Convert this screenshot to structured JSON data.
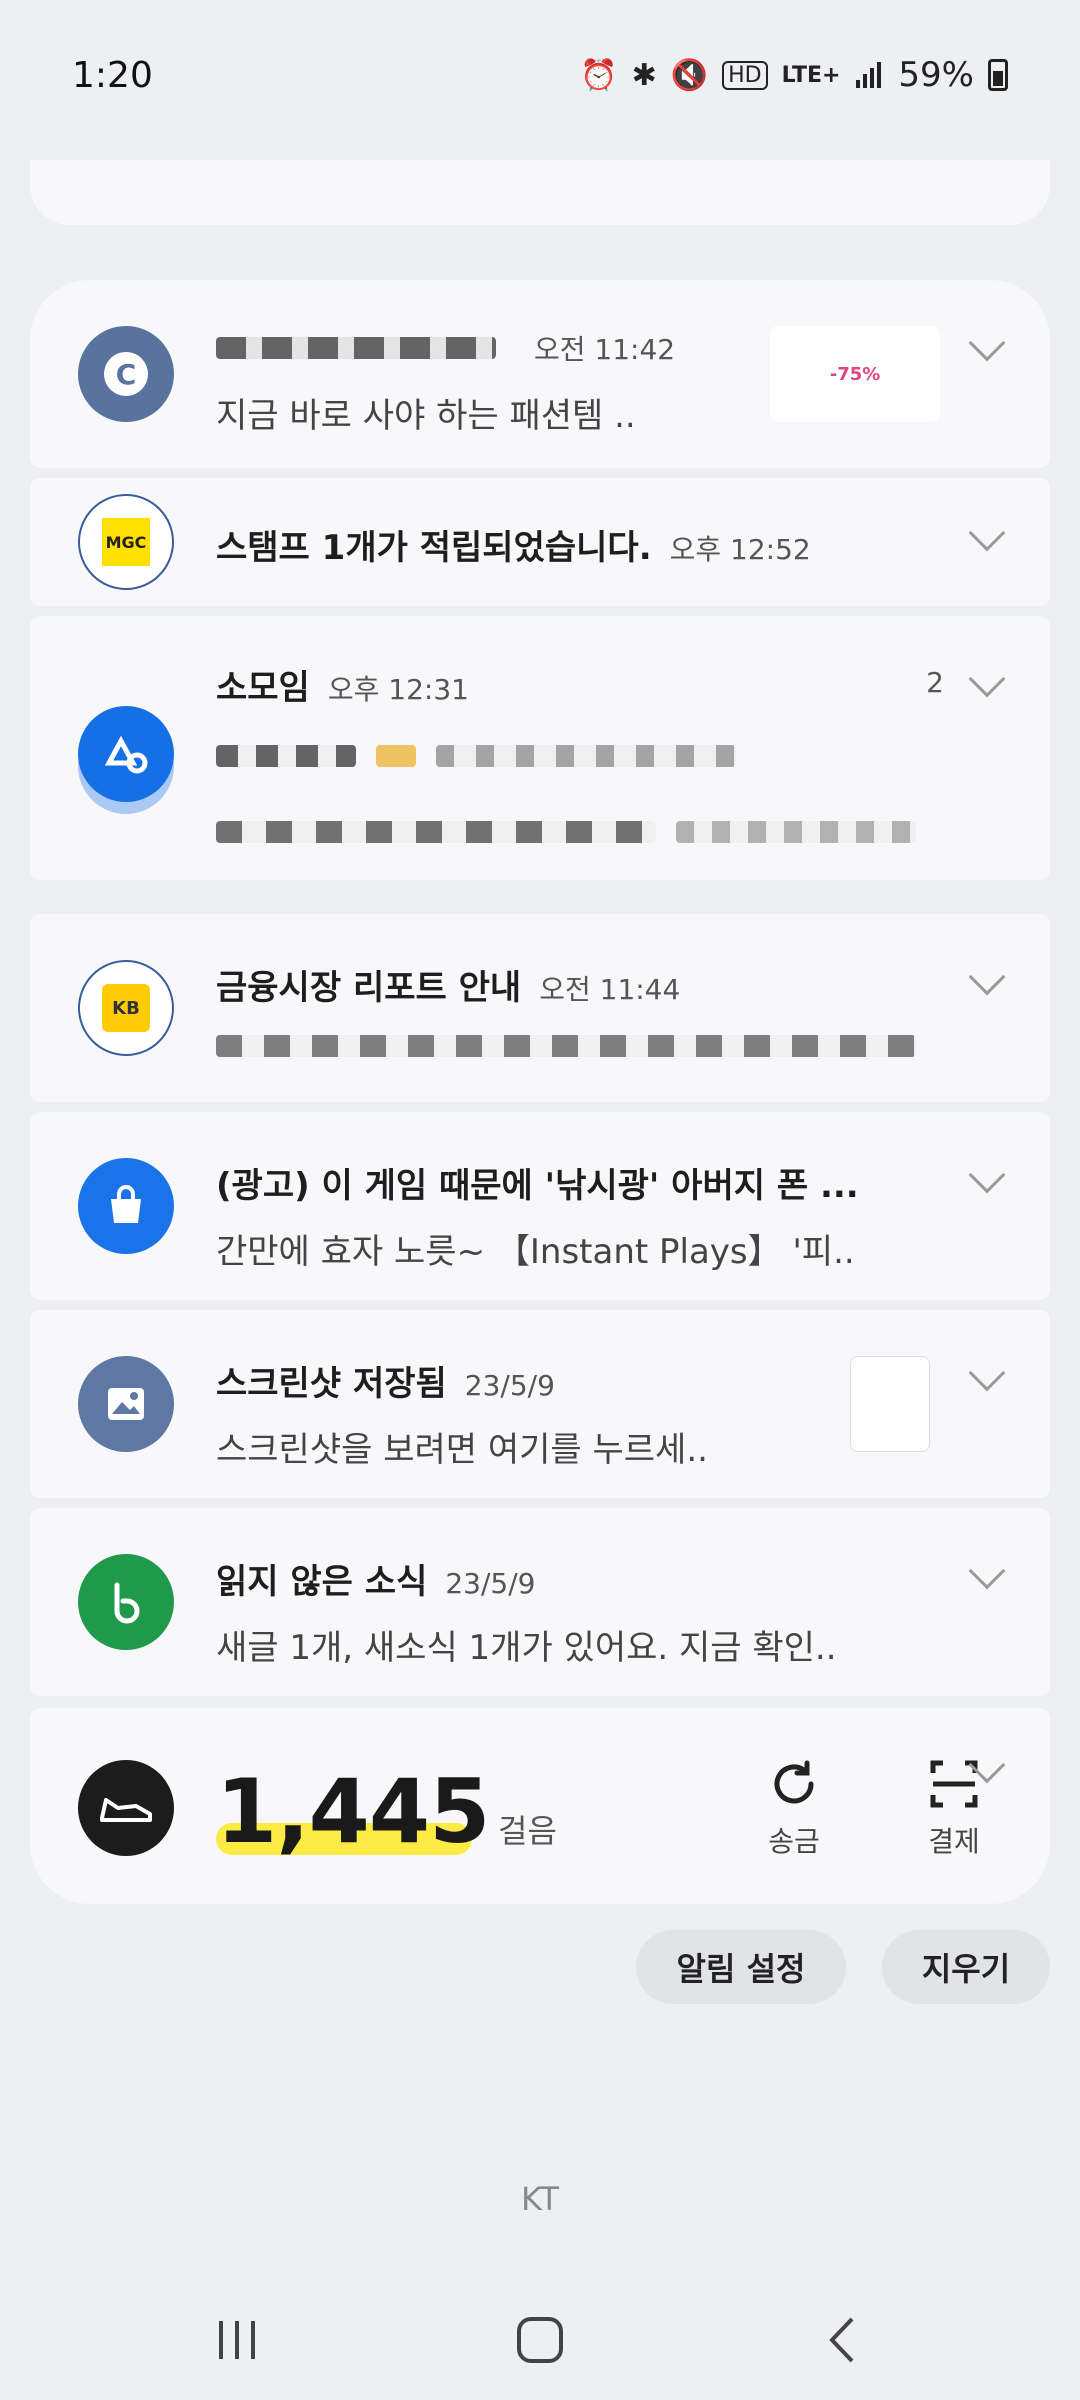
{
  "status_bar": {
    "time": "1:20",
    "network": "LTE+",
    "battery": "59%",
    "icons": [
      "alarm-icon",
      "bluetooth-icon",
      "mute-icon",
      "hd-voice-icon",
      "signal-icon",
      "battery-icon"
    ]
  },
  "notifications": [
    {
      "app_icon": "c-logo-icon",
      "title": "",
      "time": "오전 11:42",
      "body": "지금 바로 사야 하는 패션템 ..",
      "thumbnail": "-75%",
      "icon_color": "#58739e"
    },
    {
      "app_icon": "mgc-coffee-icon",
      "title": "스탬프 1개가 적립되었습니다.",
      "time": "오후 12:52",
      "body": "",
      "icon_color": "#ffe000"
    },
    {
      "app_icon": "somoim-icon",
      "title": "소모임",
      "time": "오후 12:31",
      "count": "2",
      "body": "",
      "icon_color": "#1570e6"
    },
    {
      "app_icon": "kb-securities-icon",
      "title": "금융시장 리포트 안내",
      "time": "오전 11:44",
      "body": "",
      "icon_color": "#ffcb05"
    },
    {
      "app_icon": "shopping-bag-icon",
      "title": "(광고) 이 게임 때문에 '낚시광' 아버지 폰 ...",
      "time": "",
      "body": "간만에 효자 노릇~ 【Instant Plays】 '피..",
      "icon_color": "#1a73e8"
    },
    {
      "app_icon": "gallery-icon",
      "title": "스크린샷 저장됨",
      "time": "23/5/9",
      "body": "스크린샷을 보려면 여기를 누르세..",
      "icon_color": "#5c78a3"
    },
    {
      "app_icon": "band-icon",
      "title": "읽지 않은 소식",
      "time": "23/5/9",
      "body": "새글 1개, 새소식 1개가 있어요. 지금 확인..",
      "icon_color": "#1e9a4a"
    }
  ],
  "steps": {
    "value": "1,445",
    "unit": "걸음",
    "send_label": "송금",
    "pay_label": "결제",
    "highlight_color": "#fbeb44"
  },
  "actions": {
    "settings_label": "알림 설정",
    "clear_label": "지우기"
  },
  "carrier": "KT"
}
